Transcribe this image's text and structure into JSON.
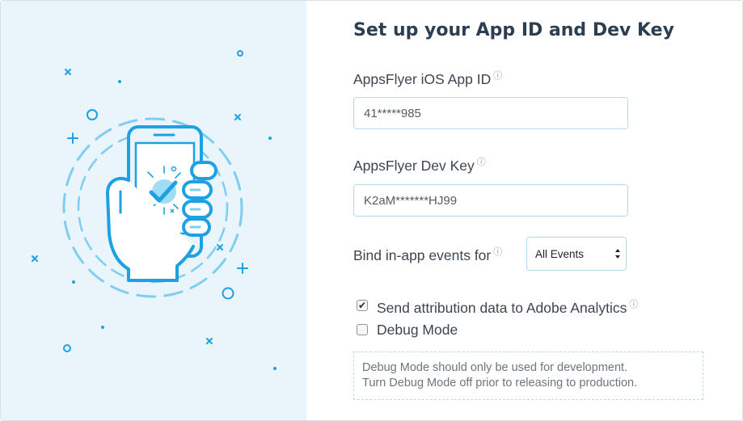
{
  "form": {
    "title": "Set up your App ID and Dev Key",
    "app_id_label": "AppsFlyer iOS App ID",
    "app_id_value": "41*****985",
    "dev_key_label": "AppsFlyer Dev Key",
    "dev_key_value": "K2aM*******HJ99",
    "bind_events_label": "Bind in-app events for",
    "bind_events_selected": "All Events",
    "send_attribution_label": "Send attribution data to Adobe Analytics",
    "send_attribution_checked": true,
    "debug_mode_label": "Debug Mode",
    "debug_mode_checked": false,
    "debug_note_line1": "Debug Mode should only be used for development.",
    "debug_note_line2": "Turn Debug Mode off prior to releasing to production.",
    "info_glyph": "ⓘ",
    "check_glyph": "✔"
  },
  "illustration": {
    "icon": "phone-in-hand-checkmark-icon",
    "accent_color": "#1da1e2",
    "light_color": "#7fcdf0"
  },
  "colors": {
    "left_panel_bg": "#e9f4fb",
    "title_color": "#2c3e50",
    "field_border": "#b6d9ee"
  }
}
